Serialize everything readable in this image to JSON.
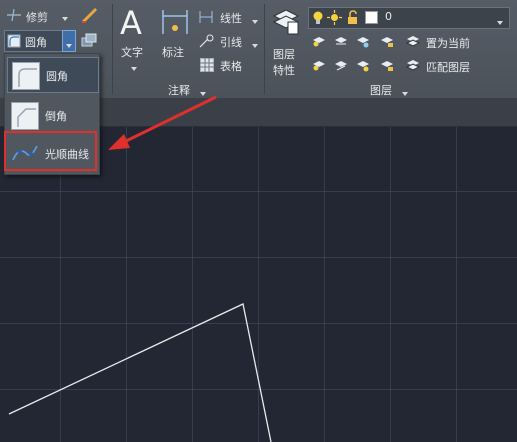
{
  "modify": {
    "trim_label": "修剪",
    "fillet_label": "圆角"
  },
  "annotation": {
    "text_label": "文字",
    "dimension_label": "标注",
    "linetype_label": "线性",
    "leader_label": "引线",
    "table_label": "表格",
    "panel_label": "注释"
  },
  "layers": {
    "properties_label_line1": "图层",
    "properties_label_line2": "特性",
    "current_layer": "0",
    "set_current_label": "置为当前",
    "match_layer_label": "匹配图层",
    "panel_label": "图层"
  },
  "dropdown": {
    "items": [
      {
        "label": "圆角"
      },
      {
        "label": "倒角"
      },
      {
        "label": "光顺曲线"
      }
    ]
  },
  "colors": {
    "highlight_box": "#e0302c",
    "arrow": "#e0302c",
    "canvas": "#232733",
    "ribbon": "#52585f"
  }
}
